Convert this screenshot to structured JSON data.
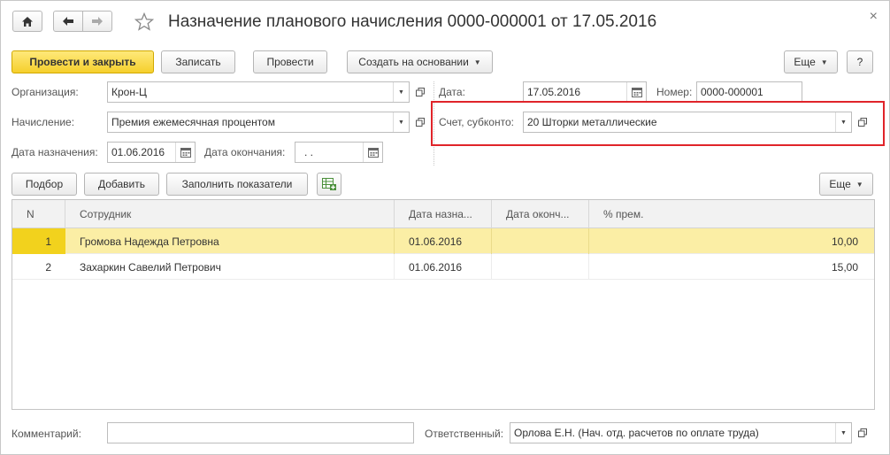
{
  "window": {
    "title": "Назначение планового начисления 0000-000001 от 17.05.2016",
    "close_glyph": "×"
  },
  "toolbar": {
    "post_close": "Провести и закрыть",
    "save": "Записать",
    "post": "Провести",
    "create_based": "Создать на основании",
    "more": "Еще",
    "help": "?"
  },
  "form": {
    "organization_label": "Организация:",
    "organization_value": "Крон-Ц",
    "accrual_label": "Начисление:",
    "accrual_value": "Премия ежемесячная процентом",
    "assign_date_label": "Дата назначения:",
    "assign_date_value": "01.06.2016",
    "end_date_label": "Дата окончания:",
    "end_date_value": " .  .",
    "date_label": "Дата:",
    "date_value": "17.05.2016",
    "number_label": "Номер:",
    "number_value": "0000-000001",
    "account_label": "Счет, субконто:",
    "account_value": "20 Шторки металлические"
  },
  "table_toolbar": {
    "pick": "Подбор",
    "add": "Добавить",
    "fill": "Заполнить показатели",
    "more": "Еще"
  },
  "table": {
    "columns": [
      "N",
      "Сотрудник",
      "Дата назна...",
      "Дата оконч...",
      "% прем."
    ],
    "rows": [
      {
        "n": "1",
        "employee": "Громова Надежда Петровна",
        "start": "01.06.2016",
        "end": "",
        "pct": "10,00"
      },
      {
        "n": "2",
        "employee": "Захаркин Савелий Петрович",
        "start": "01.06.2016",
        "end": "",
        "pct": "15,00"
      }
    ]
  },
  "footer": {
    "comment_label": "Комментарий:",
    "comment_value": "",
    "responsible_label": "Ответственный:",
    "responsible_value": "Орлова Е.Н. (Нач. отд. расчетов по оплате труда)"
  },
  "colors": {
    "primary_button": "#f5cf2c",
    "selected_row": "#fbeea5",
    "highlight_border": "#e0242a"
  },
  "icons": [
    "home-icon",
    "back-arrow-icon",
    "forward-arrow-icon",
    "star-icon",
    "calendar-icon",
    "open-icon",
    "dropdown-arrow-icon",
    "table-add-icon"
  ]
}
